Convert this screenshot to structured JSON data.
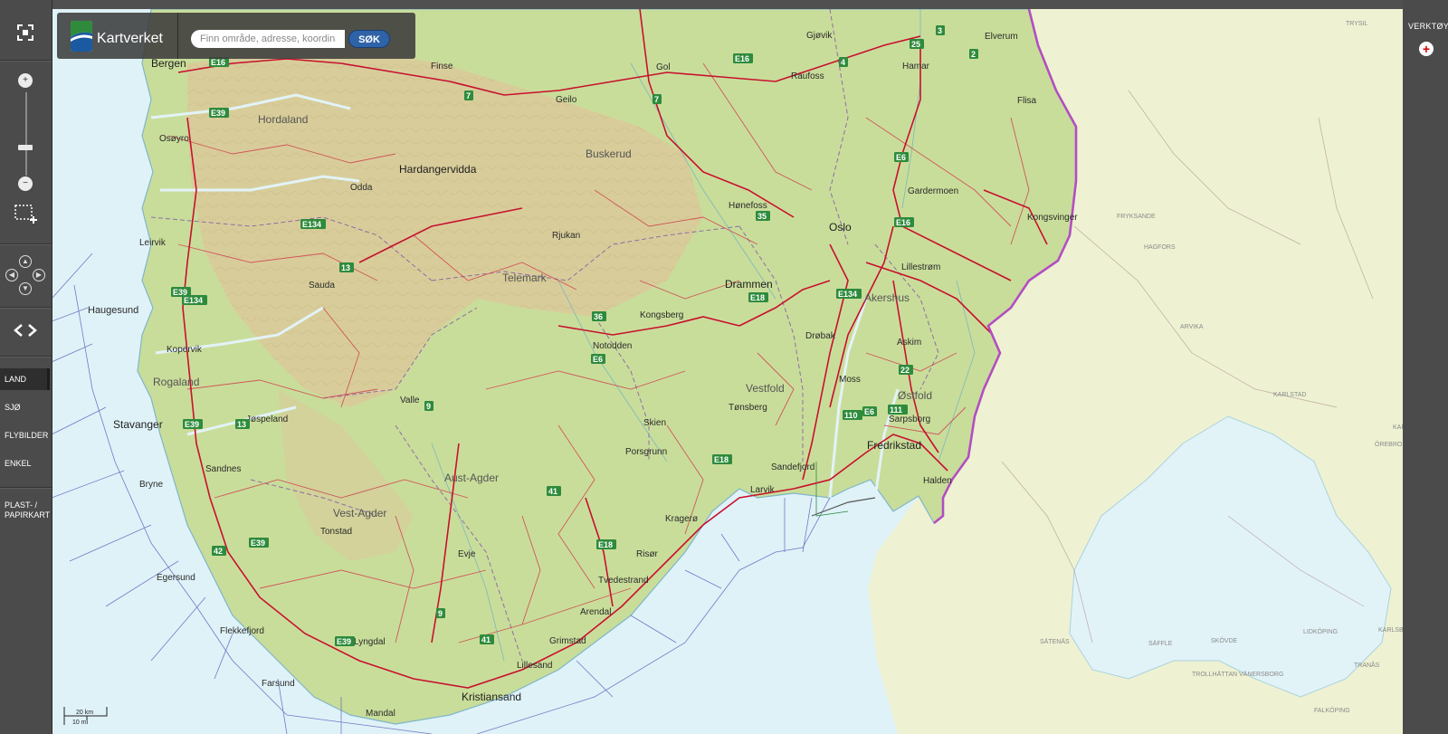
{
  "brand": {
    "name": "Kartverket"
  },
  "search": {
    "placeholder": "Finn område, adresse, koordinat",
    "button": "SØK"
  },
  "controls": {
    "zoom_in": "+",
    "zoom_out": "−"
  },
  "layers": [
    {
      "label": "LAND",
      "active": true
    },
    {
      "label": "SJØ",
      "active": false
    },
    {
      "label": "FLYBILDER",
      "active": false
    },
    {
      "label": "ENKEL",
      "active": false
    }
  ],
  "paper_maps": "PLAST- / PAPIRKART",
  "tools": {
    "label": "VERKTØY"
  },
  "scale": {
    "km": "20 km",
    "mi": "10 mi"
  },
  "colors": {
    "sea": "#dff2f8",
    "land": "#c9dd9a",
    "mountain": "#dcc79a",
    "sweden": "#f0f3d6",
    "road": "#c8102e",
    "border": "#b24ec2"
  },
  "map": {
    "places": [
      {
        "name": "Bergen",
        "size": "big"
      },
      {
        "name": "Finse",
        "size": "sm"
      },
      {
        "name": "Gol",
        "size": "sm"
      },
      {
        "name": "Gjøvik",
        "size": "sm"
      },
      {
        "name": "Elverum",
        "size": "sm"
      },
      {
        "name": "Hamar",
        "size": "sm"
      },
      {
        "name": "Raufoss",
        "size": "sm"
      },
      {
        "name": "Flisa",
        "size": "sm"
      },
      {
        "name": "Geilo",
        "size": "sm"
      },
      {
        "name": "Osøyro",
        "size": "sm"
      },
      {
        "name": "Hardangervidda",
        "size": "big"
      },
      {
        "name": "Odda",
        "size": "sm"
      },
      {
        "name": "Hønefoss",
        "size": "sm"
      },
      {
        "name": "Gardermoen",
        "size": "sm"
      },
      {
        "name": "Kongsvinger",
        "size": "sm"
      },
      {
        "name": "Oslo",
        "size": "big"
      },
      {
        "name": "Lillestrøm",
        "size": "sm"
      },
      {
        "name": "Leirvik",
        "size": "sm"
      },
      {
        "name": "Rjukan",
        "size": "sm"
      },
      {
        "name": "Sauda",
        "size": "sm"
      },
      {
        "name": "Drammen",
        "size": "big"
      },
      {
        "name": "Haugesund",
        "size": "mid"
      },
      {
        "name": "Kongsberg",
        "size": "sm"
      },
      {
        "name": "Drøbak",
        "size": "sm"
      },
      {
        "name": "Askim",
        "size": "sm"
      },
      {
        "name": "Kopervik",
        "size": "sm"
      },
      {
        "name": "Notodden",
        "size": "sm"
      },
      {
        "name": "Moss",
        "size": "sm"
      },
      {
        "name": "Valle",
        "size": "sm"
      },
      {
        "name": "Tønsberg",
        "size": "sm"
      },
      {
        "name": "Jøspeland",
        "size": "sm"
      },
      {
        "name": "Stavanger",
        "size": "big"
      },
      {
        "name": "Skien",
        "size": "sm"
      },
      {
        "name": "Sarpsborg",
        "size": "sm"
      },
      {
        "name": "Fredrikstad",
        "size": "big"
      },
      {
        "name": "Porsgrunn",
        "size": "sm"
      },
      {
        "name": "Sandnes",
        "size": "sm"
      },
      {
        "name": "Sandefjord",
        "size": "sm"
      },
      {
        "name": "Bryne",
        "size": "sm"
      },
      {
        "name": "Larvik",
        "size": "sm"
      },
      {
        "name": "Halden",
        "size": "sm"
      },
      {
        "name": "Kragerø",
        "size": "sm"
      },
      {
        "name": "Tonstad",
        "size": "sm"
      },
      {
        "name": "Risør",
        "size": "sm"
      },
      {
        "name": "Egersund",
        "size": "sm"
      },
      {
        "name": "Evje",
        "size": "sm"
      },
      {
        "name": "Tvedestrand",
        "size": "sm"
      },
      {
        "name": "Arendal",
        "size": "sm"
      },
      {
        "name": "Flekkefjord",
        "size": "sm"
      },
      {
        "name": "Lyngdal",
        "size": "sm"
      },
      {
        "name": "Grimstad",
        "size": "sm"
      },
      {
        "name": "Lillesand",
        "size": "sm"
      },
      {
        "name": "Farsund",
        "size": "sm"
      },
      {
        "name": "Kristiansand",
        "size": "big"
      },
      {
        "name": "Mandal",
        "size": "sm"
      }
    ],
    "regions": [
      "Hordaland",
      "Buskerud",
      "Telemark",
      "Akershus",
      "Rogaland",
      "Vestfold",
      "Østfold",
      "Aust-Agder",
      "Vest-Agder"
    ],
    "foreign_places": [
      "TRYSIL",
      "FRYKSANDE",
      "HAGFORS",
      "ARVIKA",
      "KARLSTAD",
      "KARLSKOGA",
      "ÖREBRO",
      "SÄFFLE",
      "SKÖVDE",
      "LIDKÖPING",
      "KARLSBORG",
      "TRANÅS",
      "TROLLHÄTTAN VÄNERSBORG",
      "FALKÖPING",
      "SÄTENÄS"
    ],
    "routes": [
      "E16",
      "E16",
      "E39",
      "7",
      "7",
      "25",
      "3",
      "2",
      "4",
      "E6",
      "E16",
      "E134",
      "13",
      "E39",
      "E134",
      "35",
      "E18",
      "E134",
      "36",
      "E6",
      "22",
      "E39",
      "9",
      "13",
      "110",
      "E6",
      "111",
      "E18",
      "41",
      "E39",
      "42",
      "E18",
      "9",
      "E39",
      "41"
    ]
  }
}
